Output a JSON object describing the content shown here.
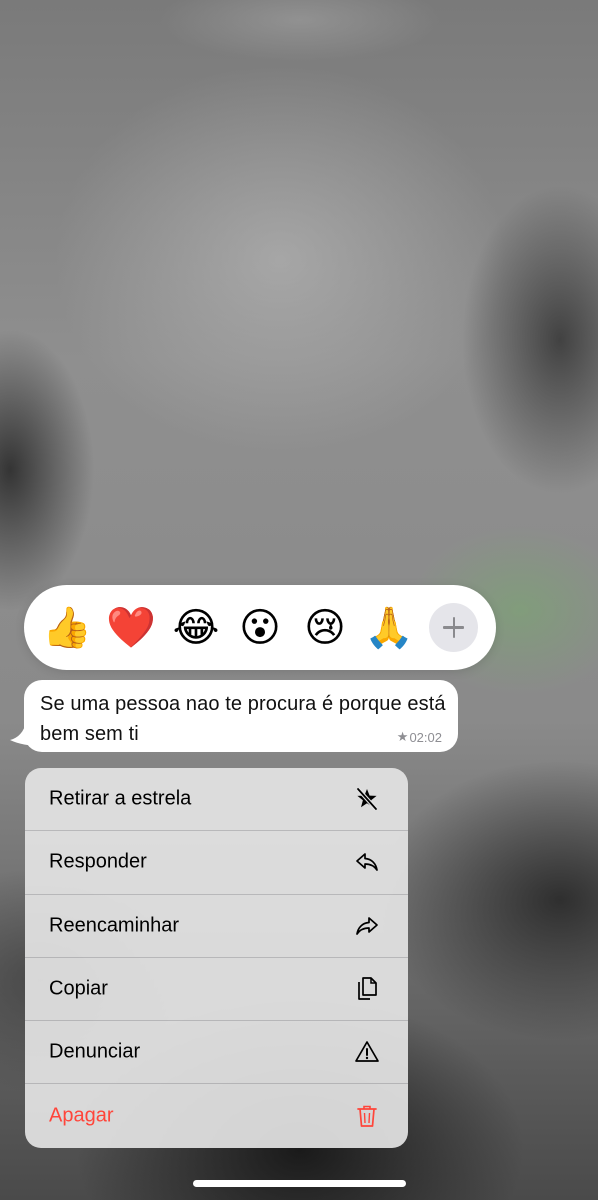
{
  "reactions": {
    "emojis": [
      "👍",
      "❤️",
      "😂",
      "😮",
      "😢",
      "🙏"
    ],
    "more_icon": "plus-icon"
  },
  "message": {
    "text": "Se uma pessoa nao te procura é porque está bem sem ti",
    "time": "02:02",
    "starred": true
  },
  "menu": {
    "items": [
      {
        "label": "Retirar a estrela",
        "icon": "unstar-icon"
      },
      {
        "label": "Responder",
        "icon": "reply-icon"
      },
      {
        "label": "Reencaminhar",
        "icon": "forward-icon"
      },
      {
        "label": "Copiar",
        "icon": "copy-icon"
      },
      {
        "label": "Denunciar",
        "icon": "warning-icon"
      },
      {
        "label": "Apagar",
        "icon": "trash-icon"
      }
    ]
  },
  "colors": {
    "destructive": "#ff453a",
    "meta": "#8e8e93"
  }
}
